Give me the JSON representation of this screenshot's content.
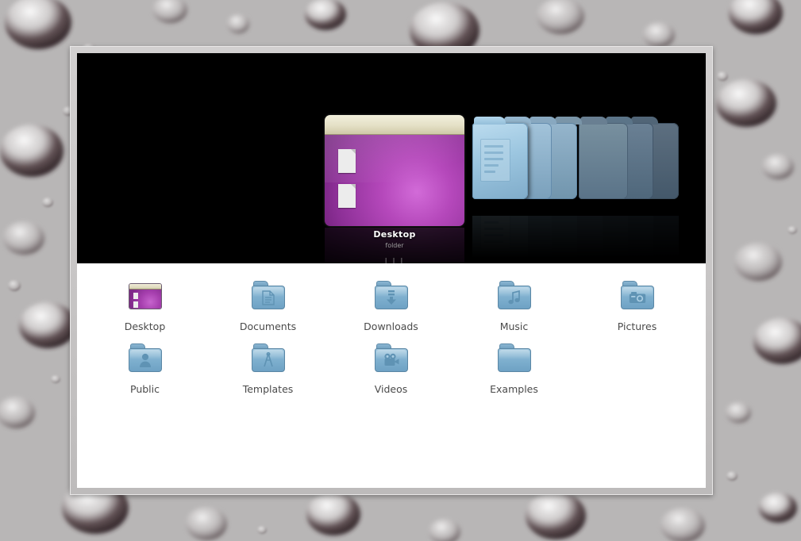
{
  "desktop": {
    "wallpaper_name": "water-droplets-wallpaper",
    "background_color": "#b8b6b6"
  },
  "window": {
    "frame_color": "#cfcdcd",
    "coverflow": {
      "background_color": "#000000",
      "selected_item": {
        "label": "Desktop",
        "sublabel": "folder",
        "icon": "desktop-folder-icon",
        "accent_color": "#b548bb"
      },
      "pager_indicator": "| | |",
      "stack_items": [
        {
          "name": "folder-documents",
          "icon": "document-folder-icon"
        },
        {
          "name": "folder-2"
        },
        {
          "name": "folder-3"
        },
        {
          "name": "folder-4"
        },
        {
          "name": "folder-5"
        },
        {
          "name": "folder-6"
        },
        {
          "name": "folder-7"
        }
      ],
      "stack_colors": [
        "#9fc9e2",
        "#93bcd6",
        "#86aec8",
        "#7ba0b9",
        "#6b8ca4",
        "#5d7b90",
        "#51697c"
      ]
    },
    "icon_grid": {
      "background_color": "#ffffff",
      "label_color": "#4a4a4a",
      "rows": [
        [
          {
            "label": "Desktop",
            "icon": "desktop-folder-icon",
            "glyph": "desktop"
          },
          {
            "label": "Documents",
            "icon": "documents-folder-icon",
            "glyph": "document"
          },
          {
            "label": "Downloads",
            "icon": "downloads-folder-icon",
            "glyph": "download-arrow"
          },
          {
            "label": "Music",
            "icon": "music-folder-icon",
            "glyph": "music-note"
          },
          {
            "label": "Pictures",
            "icon": "pictures-folder-icon",
            "glyph": "camera"
          }
        ],
        [
          {
            "label": "Public",
            "icon": "public-folder-icon",
            "glyph": "person"
          },
          {
            "label": "Templates",
            "icon": "templates-folder-icon",
            "glyph": "compass"
          },
          {
            "label": "Videos",
            "icon": "videos-folder-icon",
            "glyph": "movie-camera"
          },
          {
            "label": "Examples",
            "icon": "examples-folder-icon",
            "glyph": "plain"
          }
        ]
      ]
    }
  }
}
